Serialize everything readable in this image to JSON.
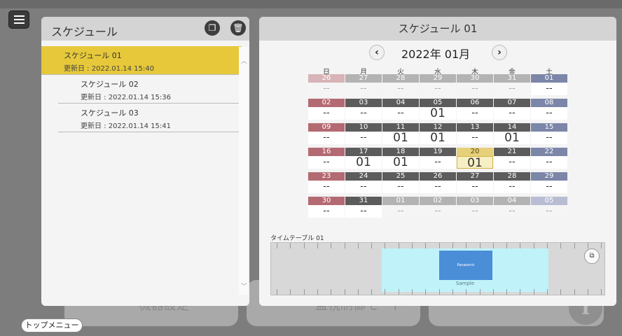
{
  "background": {
    "tile_labels": [
      "機器設定",
      "監視制御モード"
    ],
    "info_icon": "i"
  },
  "menu_icon": "hamburger-menu-icon",
  "schedule_list": {
    "title": "スケジュール",
    "copy_icon": "copy-icon",
    "delete_icon": "trash-icon",
    "items": [
      {
        "name": "スケジュール 01",
        "updated": "更新日 : 2022.01.14  15:40",
        "selected": true
      },
      {
        "name": "スケジュール 02",
        "updated": "更新日 : 2022.01.14  15:36",
        "selected": false
      },
      {
        "name": "スケジュール 03",
        "updated": "更新日 : 2022.01.14  15:41",
        "selected": false
      }
    ]
  },
  "schedule_detail": {
    "title": "スケジュール 01",
    "prev_icon": "chevron-left-icon",
    "next_icon": "chevron-right-icon",
    "month": "2022年 01月",
    "weekdays": [
      "日",
      "月",
      "火",
      "水",
      "木",
      "金",
      "土"
    ],
    "weeks": [
      [
        {
          "d": "26",
          "v": "--",
          "dim": true
        },
        {
          "d": "27",
          "v": "--",
          "dim": true
        },
        {
          "d": "28",
          "v": "--",
          "dim": true
        },
        {
          "d": "29",
          "v": "--",
          "dim": true
        },
        {
          "d": "30",
          "v": "--",
          "dim": true
        },
        {
          "d": "31",
          "v": "--",
          "dim": true
        },
        {
          "d": "01",
          "v": "--"
        }
      ],
      [
        {
          "d": "02",
          "v": "--"
        },
        {
          "d": "03",
          "v": "--"
        },
        {
          "d": "04",
          "v": "--"
        },
        {
          "d": "05",
          "v": "01"
        },
        {
          "d": "06",
          "v": "--"
        },
        {
          "d": "07",
          "v": "--"
        },
        {
          "d": "08",
          "v": "--"
        }
      ],
      [
        {
          "d": "09",
          "v": "--"
        },
        {
          "d": "10",
          "v": "--"
        },
        {
          "d": "11",
          "v": "01"
        },
        {
          "d": "12",
          "v": "01"
        },
        {
          "d": "13",
          "v": "--"
        },
        {
          "d": "14",
          "v": "01"
        },
        {
          "d": "15",
          "v": "--"
        }
      ],
      [
        {
          "d": "16",
          "v": "--"
        },
        {
          "d": "17",
          "v": "01"
        },
        {
          "d": "18",
          "v": "01"
        },
        {
          "d": "19",
          "v": "--"
        },
        {
          "d": "20",
          "v": "01",
          "today": true
        },
        {
          "d": "21",
          "v": "--"
        },
        {
          "d": "22",
          "v": "--"
        }
      ],
      [
        {
          "d": "23",
          "v": "--"
        },
        {
          "d": "24",
          "v": "--"
        },
        {
          "d": "25",
          "v": "--"
        },
        {
          "d": "26",
          "v": "--"
        },
        {
          "d": "27",
          "v": "--"
        },
        {
          "d": "28",
          "v": "--"
        },
        {
          "d": "29",
          "v": "--"
        }
      ],
      [
        {
          "d": "30",
          "v": "--"
        },
        {
          "d": "31",
          "v": "--"
        },
        {
          "d": "01",
          "v": "--",
          "dim": true
        },
        {
          "d": "02",
          "v": "--",
          "dim": true
        },
        {
          "d": "03",
          "v": "--",
          "dim": true
        },
        {
          "d": "04",
          "v": "--",
          "dim": true
        },
        {
          "d": "05",
          "v": "--",
          "dim": true
        }
      ]
    ],
    "colors": {
      "sunday": "#b46a72",
      "saturday": "#7c86a8",
      "weekday": "#5c5c5c",
      "sunday_dim": "#d8b3b7",
      "saturday_dim": "#b8bdd3",
      "weekday_dim": "#b3b3b3"
    },
    "timetable_label": "タイムテーブル 01",
    "timetable_block_label": "Panasonic",
    "timetable_sample": "Sample",
    "expand_icon": "expand-icon"
  },
  "top_menu_label": "トップメニュー"
}
